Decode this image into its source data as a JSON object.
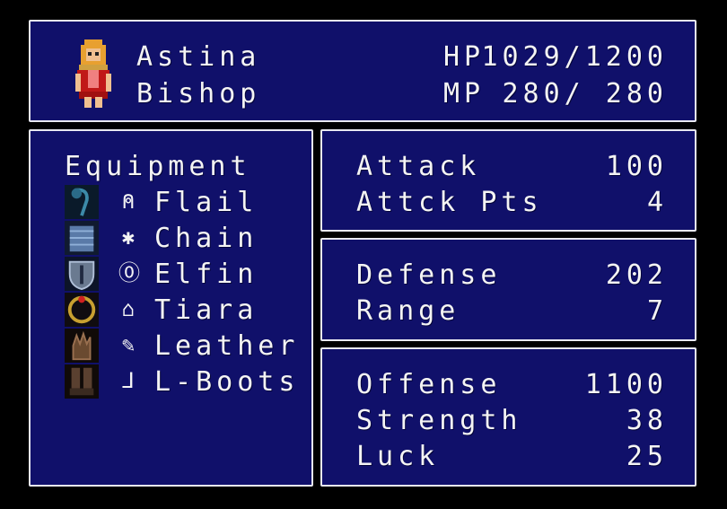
{
  "character": {
    "name": "Astina",
    "class": "Bishop",
    "hp_label": "HP",
    "hp_value": "1029∕1200",
    "mp_label": "MP",
    "mp_value": "280∕ 280"
  },
  "equipment": {
    "title": "Equipment",
    "items": [
      {
        "name": "Flail",
        "icon": "flail-icon",
        "art": "flail-art"
      },
      {
        "name": "Chain",
        "icon": "armor-icon",
        "art": "chain-mail-art"
      },
      {
        "name": "Elfin",
        "icon": "shield-icon",
        "art": "shield-art"
      },
      {
        "name": "Tiara",
        "icon": "helmet-icon",
        "art": "tiara-art"
      },
      {
        "name": "Leather",
        "icon": "glove-icon",
        "art": "glove-art"
      },
      {
        "name": "L-Boots",
        "icon": "boot-icon",
        "art": "boots-art"
      }
    ]
  },
  "stats_attack": [
    {
      "label": "Attack",
      "value": "100"
    },
    {
      "label": "Attck Pts",
      "value": "4"
    }
  ],
  "stats_defense": [
    {
      "label": "Defense",
      "value": "202"
    },
    {
      "label": "Range",
      "value": "7"
    }
  ],
  "stats_offense": [
    {
      "label": "Offense",
      "value": "1100"
    },
    {
      "label": "Strength",
      "value": "38"
    },
    {
      "label": "Luck",
      "value": "25"
    }
  ],
  "colors": {
    "panel_bg": "#10106a",
    "border": "#e8e8f0",
    "text": "#f4f4f4"
  }
}
